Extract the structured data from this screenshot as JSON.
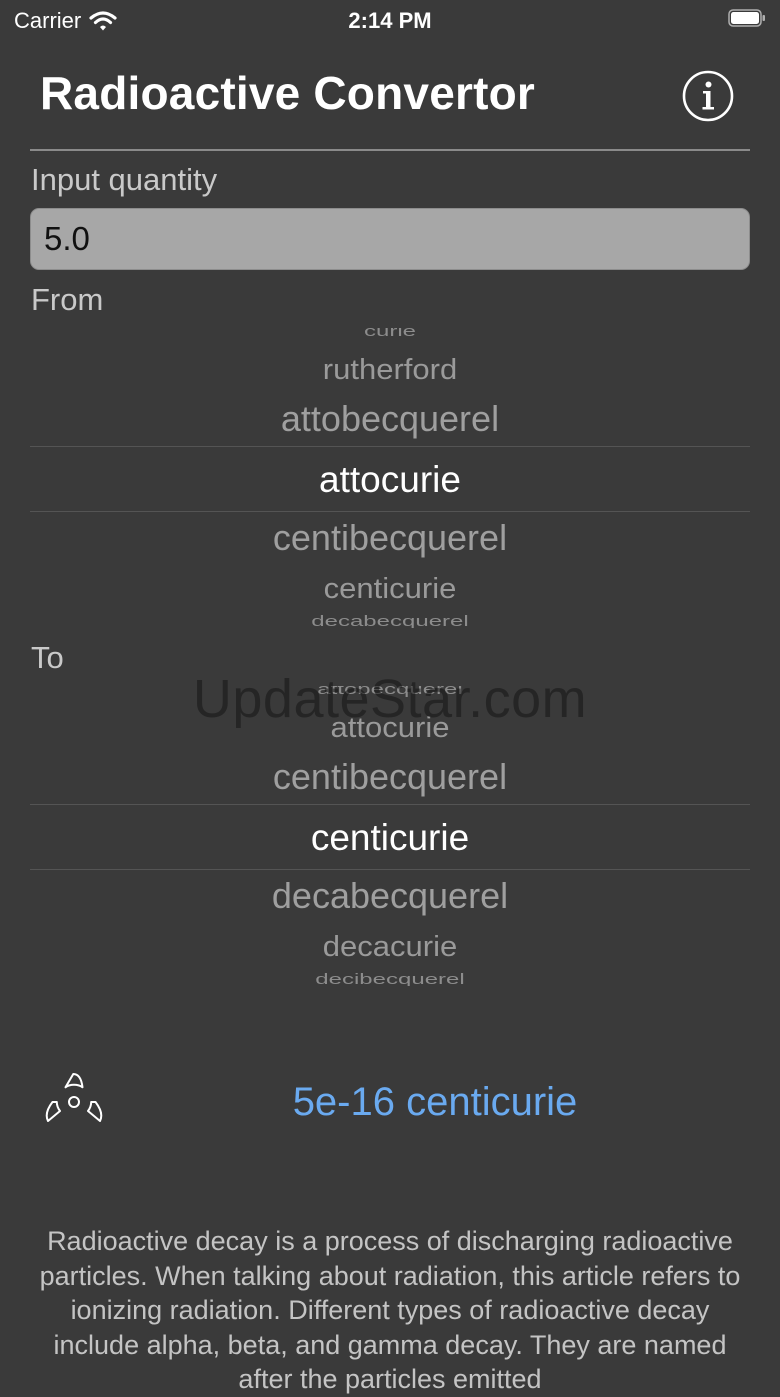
{
  "status_bar": {
    "carrier": "Carrier",
    "time": "2:14 PM"
  },
  "header": {
    "title": "Radioactive Convertor",
    "info_icon": "info-circle-icon"
  },
  "input": {
    "label": "Input quantity",
    "value": "5.0"
  },
  "from_picker": {
    "label": "From",
    "rows": {
      "top": "curie",
      "up2": "rutherford",
      "up1": "attobecquerel",
      "selected": "attocurie",
      "dn1": "centibecquerel",
      "dn2": "centicurie",
      "bottom": "decabecquerel"
    }
  },
  "to_picker": {
    "label": "To",
    "rows": {
      "top": "attobecquerel",
      "up2": "attocurie",
      "up1": "centibecquerel",
      "selected": "centicurie",
      "dn1": "decabecquerel",
      "dn2": "decacurie",
      "bottom": "decibecquerel"
    }
  },
  "watermark": "UpdateStar.com",
  "result": {
    "icon": "radiation-icon",
    "text": "5e-16 centicurie",
    "color": "#6aaaf0"
  },
  "description": "Radioactive decay is a process of discharging radioactive particles. When talking about radiation, this article refers to ionizing radiation. Different types of radioactive decay include alpha, beta, and gamma decay. They are named after the particles emitted",
  "colors": {
    "background": "#3a3a3a",
    "input_background": "#a7a7a7",
    "selected_text": "#ffffff",
    "muted_text": "#9f9f9f"
  }
}
